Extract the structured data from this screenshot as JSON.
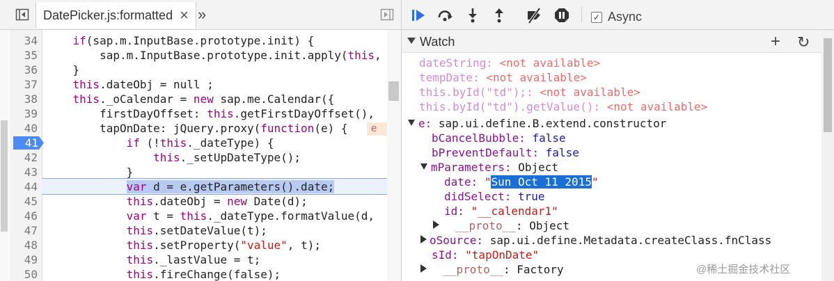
{
  "tabs": {
    "file": "DatePicker.js:formatted",
    "close": "×",
    "more": "»"
  },
  "code_lines": [
    {
      "n": "34",
      "t": [
        [
          "kw",
          "if"
        ],
        [
          "",
          "(sap.m.InputBase.prototype.init) {"
        ]
      ]
    },
    {
      "n": "35",
      "t": [
        [
          "",
          "    sap.m.InputBase.prototype.init.apply("
        ],
        [
          "kw",
          "this"
        ],
        [
          "",
          ","
        ]
      ]
    },
    {
      "n": "36",
      "t": [
        [
          "",
          "}"
        ]
      ]
    },
    {
      "n": "37",
      "t": [
        [
          "kw",
          "this"
        ],
        [
          "",
          ".dateObj = null ;"
        ]
      ]
    },
    {
      "n": "38",
      "t": [
        [
          "kw",
          "this"
        ],
        [
          "",
          "._oCalendar = "
        ],
        [
          "kw",
          "new"
        ],
        [
          "",
          " sap.me.Calendar({"
        ]
      ]
    },
    {
      "n": "39",
      "t": [
        [
          "",
          "    firstDayOffset: "
        ],
        [
          "kw",
          "this"
        ],
        [
          "",
          ".getFirstDayOffset(),"
        ]
      ]
    },
    {
      "n": "40",
      "t": [
        [
          "",
          "    tapOnDate: jQuery.proxy("
        ],
        [
          "kw",
          "function"
        ],
        [
          "",
          "(e) {"
        ]
      ]
    },
    {
      "n": "41",
      "t": [
        [
          "",
          "        "
        ],
        [
          "kw",
          "if"
        ],
        [
          "",
          " (!"
        ],
        [
          "kw",
          "this"
        ],
        [
          "",
          "._dateType) {"
        ]
      ]
    },
    {
      "n": "42",
      "t": [
        [
          "",
          "            "
        ],
        [
          "kw",
          "this"
        ],
        [
          "",
          "._setUpDateType();"
        ]
      ]
    },
    {
      "n": "43",
      "t": [
        [
          "",
          "        }"
        ]
      ]
    },
    {
      "n": "44",
      "t": [
        [
          "",
          "        "
        ],
        [
          "selkw",
          "var"
        ],
        [
          "sel",
          " d = e.getParameters().date;"
        ]
      ]
    },
    {
      "n": "45",
      "t": [
        [
          "",
          "        "
        ],
        [
          "kw",
          "this"
        ],
        [
          "",
          ".dateObj = "
        ],
        [
          "kw",
          "new"
        ],
        [
          "",
          " Date(d);"
        ]
      ]
    },
    {
      "n": "46",
      "t": [
        [
          "",
          "        "
        ],
        [
          "kw",
          "var"
        ],
        [
          "",
          " t = "
        ],
        [
          "kw",
          "this"
        ],
        [
          "",
          "._dateType.formatValue(d,"
        ]
      ]
    },
    {
      "n": "47",
      "t": [
        [
          "",
          "        "
        ],
        [
          "kw",
          "this"
        ],
        [
          "",
          ".setDateValue(t);"
        ]
      ]
    },
    {
      "n": "48",
      "t": [
        [
          "",
          "        "
        ],
        [
          "kw",
          "this"
        ],
        [
          "",
          ".setProperty("
        ],
        [
          "str",
          "\"value\""
        ],
        [
          "",
          ", t);"
        ]
      ]
    },
    {
      "n": "49",
      "t": [
        [
          "",
          "        "
        ],
        [
          "kw",
          "this"
        ],
        [
          "",
          "._lastValue = t;"
        ]
      ]
    },
    {
      "n": "50",
      "t": [
        [
          "",
          "        "
        ],
        [
          "kw",
          "this"
        ],
        [
          "",
          ".fireChange(false);"
        ]
      ]
    }
  ],
  "breakpoint_line": "41",
  "inline_value": "e",
  "async_label": "Async",
  "watch": {
    "title": "Watch",
    "add": "+",
    "refresh": "↻",
    "na": "<not available>",
    "expressions": [
      "dateString:",
      "tempDate:",
      "this.byId(\"td\");:",
      "this.byId(\"td\").getValue():"
    ],
    "e_name": "e:",
    "e_type": " sap.ui.define.B.extend.constructor",
    "bCancelBubble": "bCancelBubble:",
    "bPreventDefault": "bPreventDefault:",
    "false": " false",
    "true": " true",
    "mParameters": "mParameters:",
    "object": " Object",
    "date": "date:",
    "date_value": "Sun Oct 11 2015",
    "didSelect": "didSelect:",
    "id": "id:",
    "id_value": " \"__calendar1\"",
    "proto": "__proto__",
    "proto_object": ": Object",
    "oSource": "oSource:",
    "oSource_value": " sap.ui.define.Metadata.createClass.fnClass",
    "sId": "sId:",
    "sId_value": " \"tapOnDate\"",
    "proto_factory": ": Factory"
  },
  "watermark": "@稀土掘金技术社区"
}
